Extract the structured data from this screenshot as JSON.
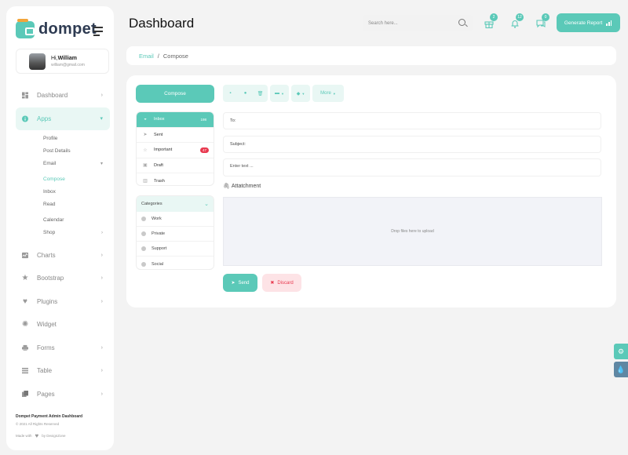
{
  "brand": {
    "name": "dompet"
  },
  "profile": {
    "greeting": "Hi,",
    "name": "William",
    "email": "william@gmail.com"
  },
  "sidebar": {
    "items": [
      {
        "label": "Dashboard",
        "icon": "dashboard-icon",
        "has_children": true
      },
      {
        "label": "Apps",
        "icon": "info-icon",
        "has_children": true,
        "active": true
      },
      {
        "label": "Charts",
        "icon": "chart-icon",
        "has_children": true
      },
      {
        "label": "Bootstrap",
        "icon": "star-icon",
        "has_children": true
      },
      {
        "label": "Plugins",
        "icon": "heart-icon",
        "has_children": true
      },
      {
        "label": "Widget",
        "icon": "settings-icon",
        "has_children": false
      },
      {
        "label": "Forms",
        "icon": "printer-icon",
        "has_children": true
      },
      {
        "label": "Table",
        "icon": "table-icon",
        "has_children": true
      },
      {
        "label": "Pages",
        "icon": "pages-icon",
        "has_children": true
      }
    ],
    "apps_sub": {
      "profile": "Profile",
      "post_details": "Post Details",
      "email": "Email",
      "compose": "Compose",
      "inbox": "Inbox",
      "read": "Read",
      "calendar": "Calendar",
      "shop": "Shop"
    }
  },
  "footer": {
    "title": "Dompet Payment Admin Dashboard",
    "copyright": "© 2021 All Rights Reserved",
    "made_with": "Made with",
    "by": "by DexignZone"
  },
  "header": {
    "title": "Dashboard",
    "search_placeholder": "Search here...",
    "gift_badge": "2",
    "bell_badge": "12",
    "chat_badge": "0",
    "generate_report": "Generate Report"
  },
  "breadcrumb": {
    "root": "Email",
    "separator": "/",
    "current": "Compose"
  },
  "mail": {
    "compose_label": "Compose",
    "more_label": "More",
    "folders": [
      {
        "label": "Inbox",
        "count": "198",
        "icon": "inbox-icon"
      },
      {
        "label": "Sent",
        "count": "",
        "icon": "send-icon"
      },
      {
        "label": "Important",
        "count": "47",
        "icon": "star-icon"
      },
      {
        "label": "Draft",
        "count": "",
        "icon": "draft-icon"
      },
      {
        "label": "Trash",
        "count": "",
        "icon": "trash-icon"
      }
    ],
    "categories_title": "Categories",
    "categories": [
      "Work",
      "Private",
      "Support",
      "Social"
    ],
    "to_placeholder": "To:",
    "subject_placeholder": "Subject:",
    "body_placeholder": "Enter text ...",
    "attachment_label": "Attatchment",
    "dropzone_text": "Drop files here to upload",
    "send_label": "Send",
    "discard_label": "Discard"
  },
  "colors": {
    "accent": "#5bc9b8",
    "accent_light": "#e9f7f4",
    "danger": "#e8394f",
    "danger_light": "#fde3e6"
  }
}
